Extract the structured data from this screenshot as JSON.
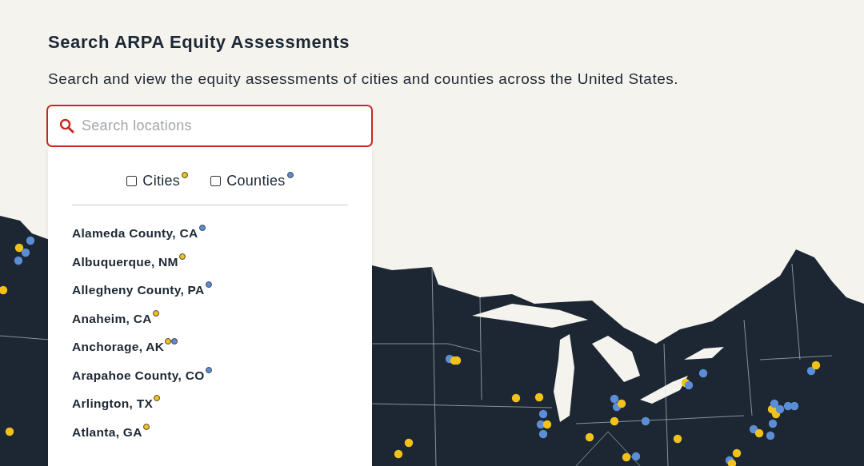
{
  "title": "Search ARPA Equity Assessments",
  "subtitle": "Search and view the equity assessments of cities and counties across the United States.",
  "search": {
    "placeholder": "Search locations"
  },
  "filters": [
    {
      "label": "Cities",
      "checked": false,
      "color": "#f2c21b"
    },
    {
      "label": "Counties",
      "checked": false,
      "color": "#5b8ed6"
    }
  ],
  "results": [
    {
      "name": "Alameda County, CA",
      "dots": [
        {
          "color": "#5b8ed6"
        }
      ]
    },
    {
      "name": "Albuquerque, NM",
      "dots": [
        {
          "color": "#f2c21b"
        }
      ]
    },
    {
      "name": "Allegheny County, PA",
      "dots": [
        {
          "color": "#5b8ed6"
        }
      ]
    },
    {
      "name": "Anaheim, CA",
      "dots": [
        {
          "color": "#f2c21b"
        }
      ]
    },
    {
      "name": "Anchorage, AK",
      "dots": [
        {
          "color": "#f2c21b"
        },
        {
          "color": "#5b8ed6"
        }
      ]
    },
    {
      "name": "Arapahoe County, CO",
      "dots": [
        {
          "color": "#5b8ed6"
        }
      ]
    },
    {
      "name": "Arlington, TX",
      "dots": [
        {
          "color": "#f2c21b"
        }
      ]
    },
    {
      "name": "Atlanta, GA",
      "dots": [
        {
          "color": "#f2c21b"
        }
      ]
    }
  ]
}
